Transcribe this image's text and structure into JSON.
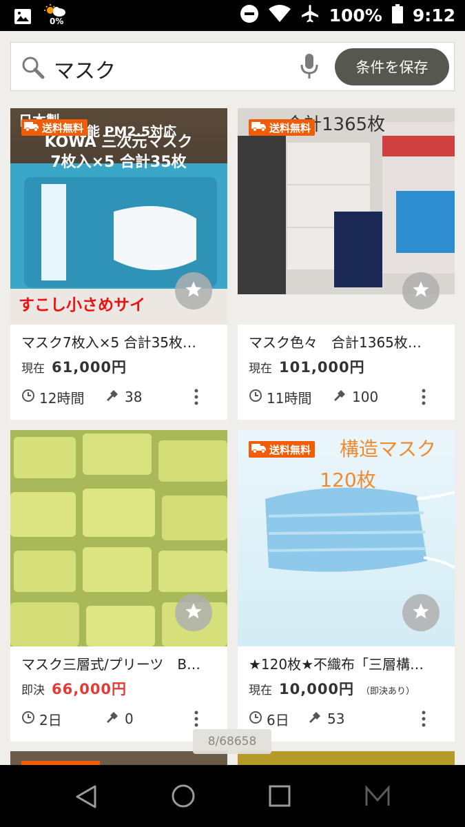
{
  "status_bar": {
    "battery_pct": "100%",
    "time": "9:12",
    "weather_pct": "0%",
    "icons": [
      "image-icon",
      "weather-icon",
      "dnd-icon",
      "wifi-icon",
      "airplane-icon",
      "battery-icon"
    ]
  },
  "search": {
    "query": "マスク",
    "save_label": "条件を保存"
  },
  "badge_label": "送料無料",
  "items": [
    {
      "title": "マスク7枚入×5 合計35枚…",
      "price_label": "現在",
      "price": "61,000円",
      "price_note": "",
      "time_left": "12時間",
      "bids": "38",
      "free_shipping": true,
      "image_texts": {
        "t1": "日本製",
        "t2": "高機能 PM2.5対応",
        "t3": "KOWA 三次元マスク",
        "t4": "7枚入×5 合計35枚",
        "t5": "すこし小さめサイ"
      }
    },
    {
      "title": "マスク色々　合計1365枚…",
      "price_label": "現在",
      "price": "101,000円",
      "price_note": "",
      "time_left": "11時間",
      "bids": "100",
      "free_shipping": true,
      "image_texts": {
        "t1": "合計1365枚"
      }
    },
    {
      "title": "マスク三層式/プリーツ　B…",
      "price_label": "即決",
      "price": "66,000円",
      "price_note": "",
      "time_left": "2日",
      "bids": "0",
      "free_shipping": false,
      "image_texts": {}
    },
    {
      "title": "★120枚★不織布「三層構…",
      "price_label": "現在",
      "price": "10,000円",
      "price_note": "（即決あり）",
      "time_left": "6日",
      "bids": "53",
      "free_shipping": true,
      "image_texts": {
        "t1": "構造マスク",
        "t2": "120枚"
      }
    }
  ],
  "counter": "8/68658",
  "colors": {
    "badge": "#f25c05",
    "price_red": "#e53935",
    "save_button": "#56574f",
    "background": "#efeeea"
  }
}
